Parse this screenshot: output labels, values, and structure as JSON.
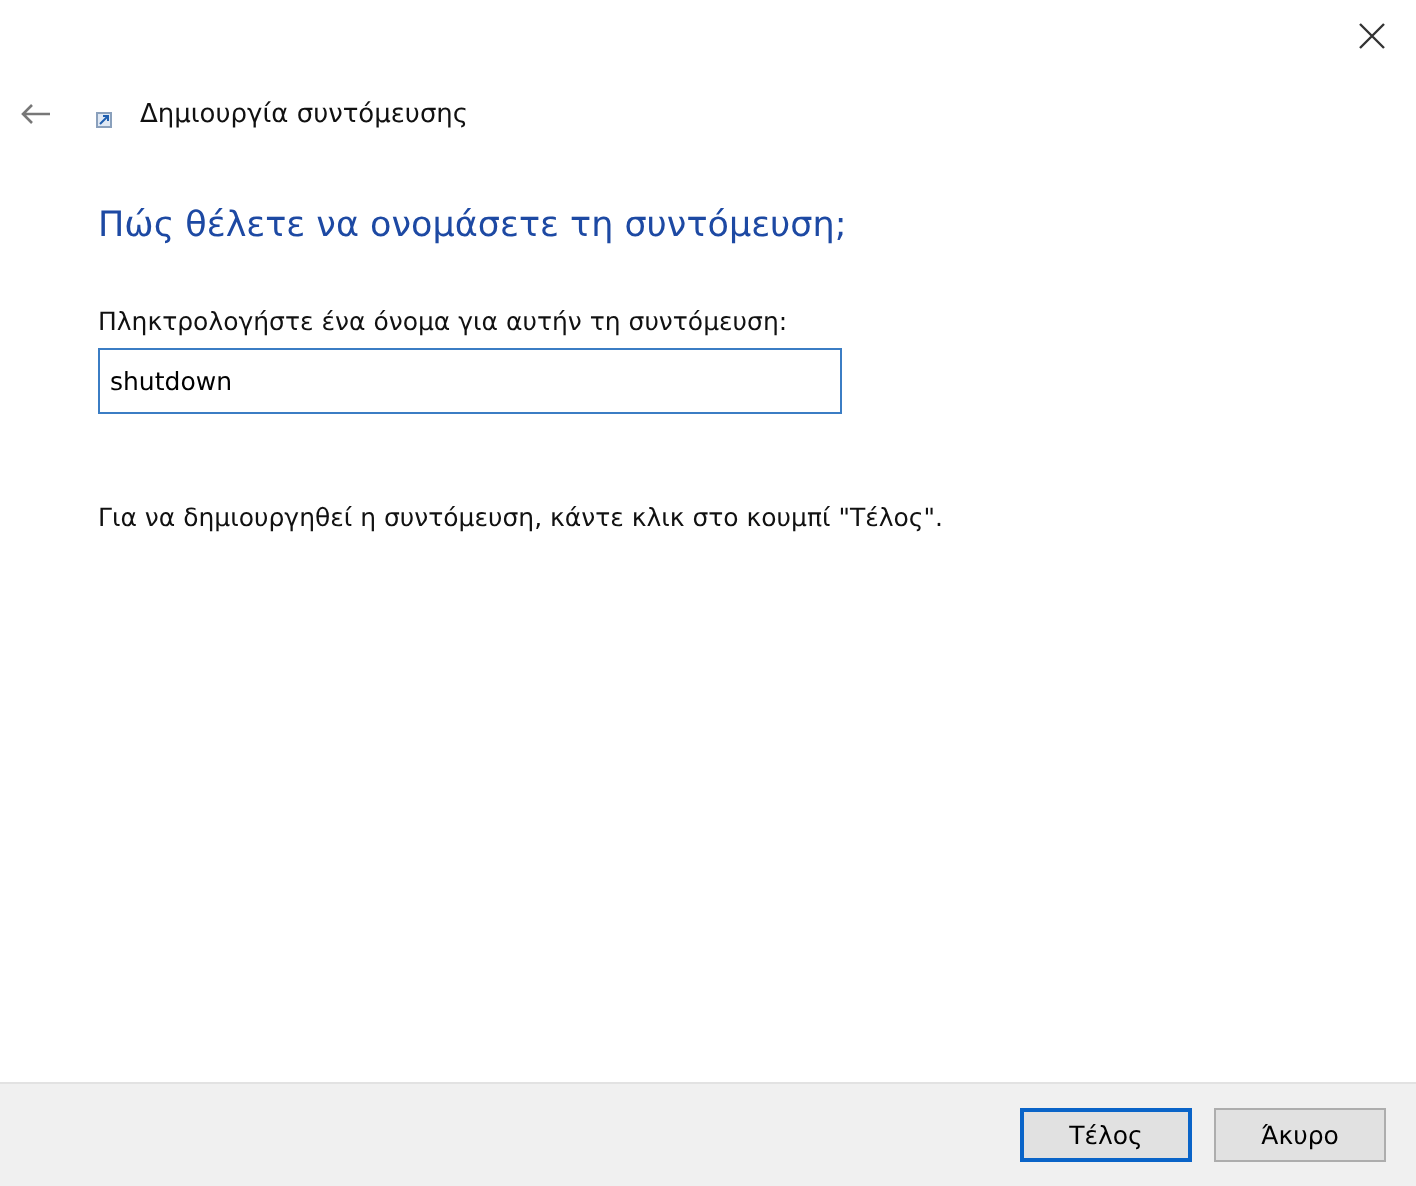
{
  "window": {
    "title": "Δημιουργία συντόμευσης"
  },
  "heading": "Πώς θέλετε να ονομάσετε τη συντόμευση;",
  "name_field": {
    "label": "Πληκτρολογήστε ένα όνομα για αυτήν τη συντόμευση:",
    "value": "shutdown"
  },
  "instruction": "Για να δημιουργηθεί η συντόμευση, κάντε κλικ στο κουμπί \"Τέλος\".",
  "buttons": [
    {
      "label": "Τέλος",
      "default": true
    },
    {
      "label": "Άκυρο",
      "default": false
    }
  ]
}
